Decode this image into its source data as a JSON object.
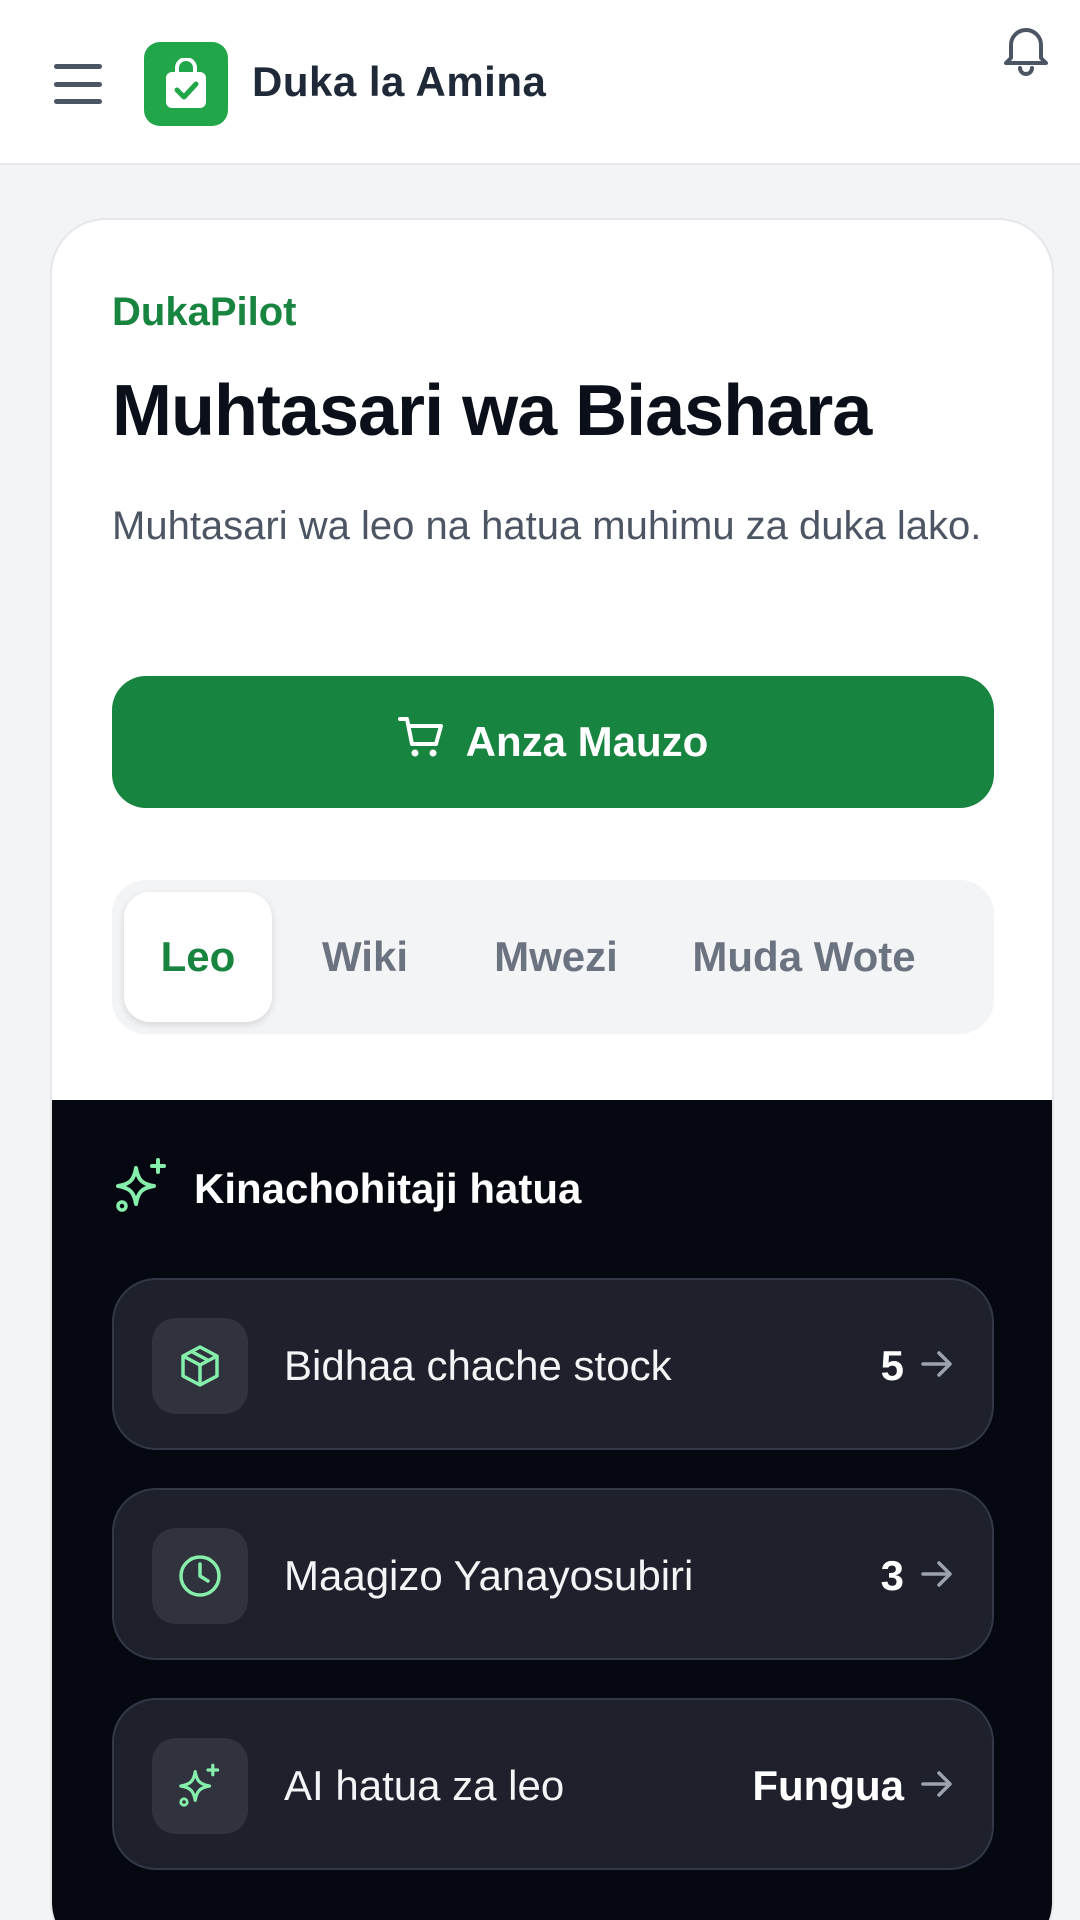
{
  "header": {
    "store_name": "Duka la Amina",
    "menu_icon": "hamburger-menu-icon",
    "logo_icon": "shopping-bag-check-icon",
    "notification_icon": "bell-icon"
  },
  "summary": {
    "kicker": "DukaPilot",
    "title": "Muhtasari wa Biashara",
    "subtitle": "Muhtasari wa leo na hatua muhimu za duka lako.",
    "primary_button_label": "Anza Mauzo",
    "primary_button_icon": "cart-icon",
    "tabs": [
      {
        "label": "Leo",
        "active": true
      },
      {
        "label": "Wiki",
        "active": false
      },
      {
        "label": "Mwezi",
        "active": false
      },
      {
        "label": "Muda Wote",
        "active": false
      }
    ]
  },
  "actions": {
    "title": "Kinachohitaji hatua",
    "title_icon": "sparkles-icon",
    "items": [
      {
        "label": "Bidhaa chache stock",
        "value": "5",
        "icon": "package-icon"
      },
      {
        "label": "Maagizo Yanayosubiri",
        "value": "3",
        "icon": "clock-icon"
      },
      {
        "label": "AI hatua za leo",
        "value": "Fungua",
        "icon": "sparkles-icon"
      }
    ]
  },
  "colors": {
    "brand_green": "#17843f",
    "logo_green": "#21a64a",
    "dark_panel": "#050811",
    "row_bg": "#1e212b",
    "accent_mint": "#86efac"
  }
}
